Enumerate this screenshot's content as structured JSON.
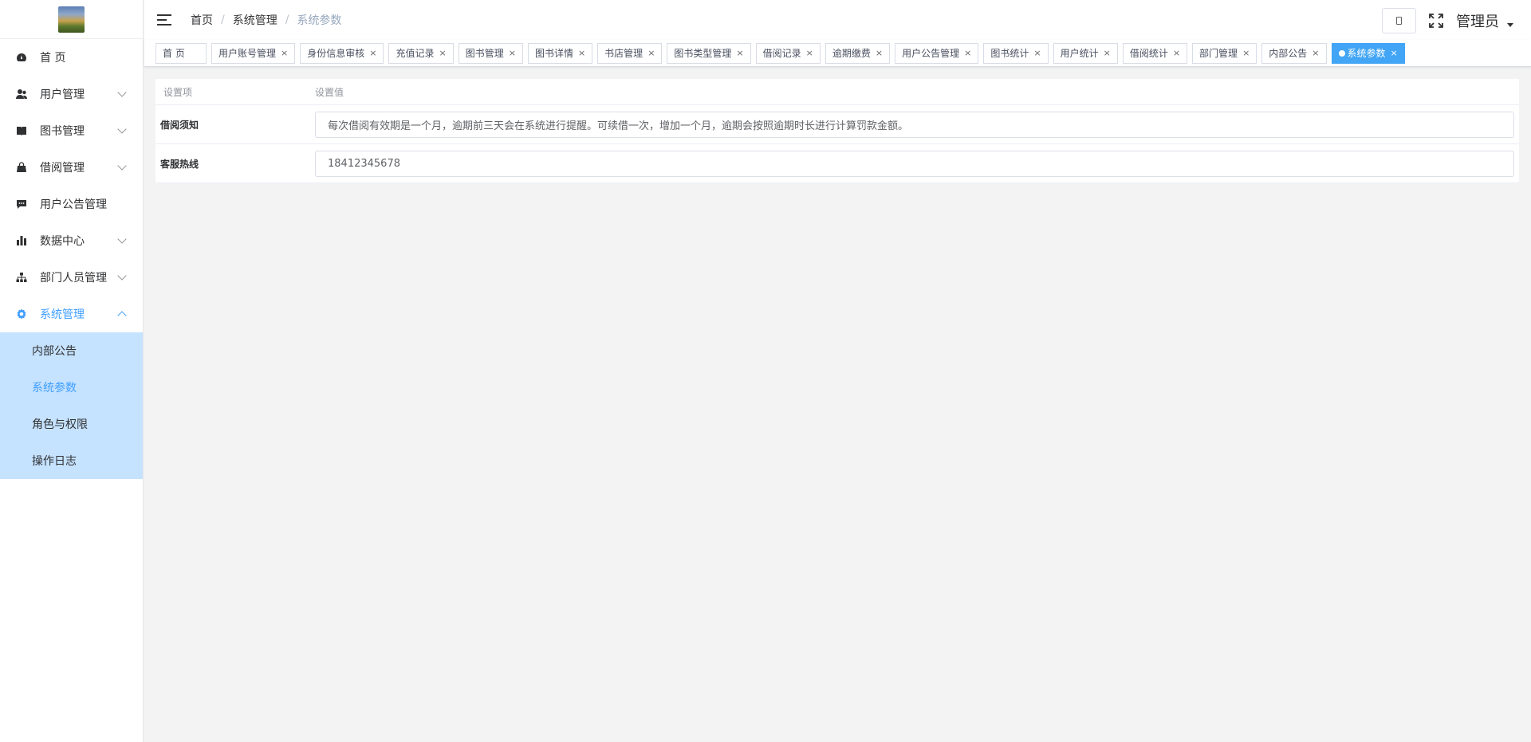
{
  "sidebar": {
    "items": [
      {
        "label": "首 页",
        "has_children": false
      },
      {
        "label": "用户管理",
        "has_children": true
      },
      {
        "label": "图书管理",
        "has_children": true
      },
      {
        "label": "借阅管理",
        "has_children": true
      },
      {
        "label": "用户公告管理",
        "has_children": false
      },
      {
        "label": "数据中心",
        "has_children": true
      },
      {
        "label": "部门人员管理",
        "has_children": true
      },
      {
        "label": "系统管理",
        "has_children": true,
        "open": true
      }
    ],
    "submenu": [
      {
        "label": "内部公告"
      },
      {
        "label": "系统参数",
        "active": true
      },
      {
        "label": "角色与权限"
      },
      {
        "label": "操作日志"
      }
    ]
  },
  "header": {
    "breadcrumb": [
      "首页",
      "系统管理",
      "系统参数"
    ],
    "user_name": "管理员"
  },
  "tags": [
    {
      "label": "首 页",
      "closable": false
    },
    {
      "label": "用户账号管理",
      "closable": true
    },
    {
      "label": "身份信息审核",
      "closable": true
    },
    {
      "label": "充值记录",
      "closable": true
    },
    {
      "label": "图书管理",
      "closable": true
    },
    {
      "label": "图书详情",
      "closable": true
    },
    {
      "label": "书店管理",
      "closable": true
    },
    {
      "label": "图书类型管理",
      "closable": true
    },
    {
      "label": "借阅记录",
      "closable": true
    },
    {
      "label": "逾期缴费",
      "closable": true
    },
    {
      "label": "用户公告管理",
      "closable": true
    },
    {
      "label": "图书统计",
      "closable": true
    },
    {
      "label": "用户统计",
      "closable": true
    },
    {
      "label": "借阅统计",
      "closable": true
    },
    {
      "label": "部门管理",
      "closable": true
    },
    {
      "label": "内部公告",
      "closable": true
    },
    {
      "label": "系统参数",
      "closable": true,
      "active": true
    }
  ],
  "table": {
    "col_key": "设置项",
    "col_value": "设置值",
    "rows": [
      {
        "key": "借阅须知",
        "value": "每次借阅有效期是一个月，逾期前三天会在系统进行提醒。可续借一次，增加一个月，逾期会按照逾期时长进行计算罚款金额。"
      },
      {
        "key": "客服热线",
        "value": "18412345678"
      }
    ]
  },
  "colors": {
    "accent": "#409eff",
    "active_tag": "#42a5f5",
    "submenu_bg": "#c5e2ff"
  }
}
